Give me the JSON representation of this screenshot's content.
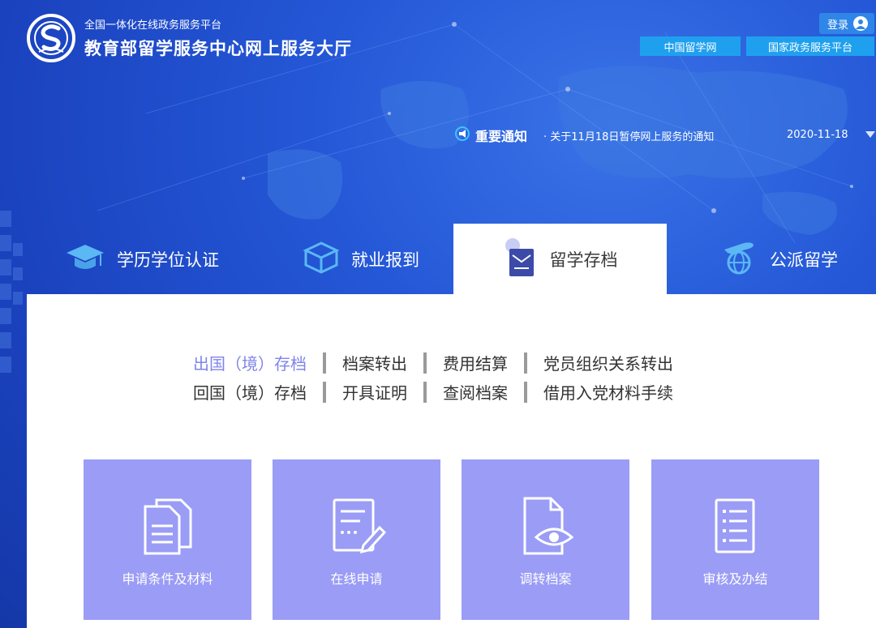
{
  "header": {
    "platform_sub": "全国一体化在线政务服务平台",
    "platform_title": "教育部留学服务中心网上服务大厅",
    "login_label": "登录",
    "links": [
      "中国留学网",
      "国家政务服务平台"
    ]
  },
  "notice": {
    "label": "重要通知",
    "text": "· 关于11月18日暂停网上服务的通知",
    "date": "2020-11-18"
  },
  "tabs": [
    {
      "label": "学历学位认证",
      "icon": "graduation-cap-icon"
    },
    {
      "label": "就业报到",
      "icon": "cube-icon"
    },
    {
      "label": "留学存档",
      "icon": "archive-envelope-icon",
      "active": true
    },
    {
      "label": "公派留学",
      "icon": "plane-globe-icon"
    }
  ],
  "subnav": {
    "row1": [
      "出国（境）存档",
      "档案转出",
      "费用结算",
      "党员组织关系转出"
    ],
    "row2": [
      "回国（境）存档",
      "开具证明",
      "查阅档案",
      "借用入党材料手续"
    ]
  },
  "steps": [
    {
      "label": "申请条件及材料",
      "icon": "documents-icon"
    },
    {
      "label": "在线申请",
      "icon": "form-edit-icon"
    },
    {
      "label": "调转档案",
      "icon": "file-view-icon"
    },
    {
      "label": "审核及办结",
      "icon": "checklist-icon"
    }
  ],
  "colors": {
    "step_bg": "#9a9cf6",
    "active_subnav": "#7f84ea",
    "link_bg": "#1fa0ef"
  }
}
